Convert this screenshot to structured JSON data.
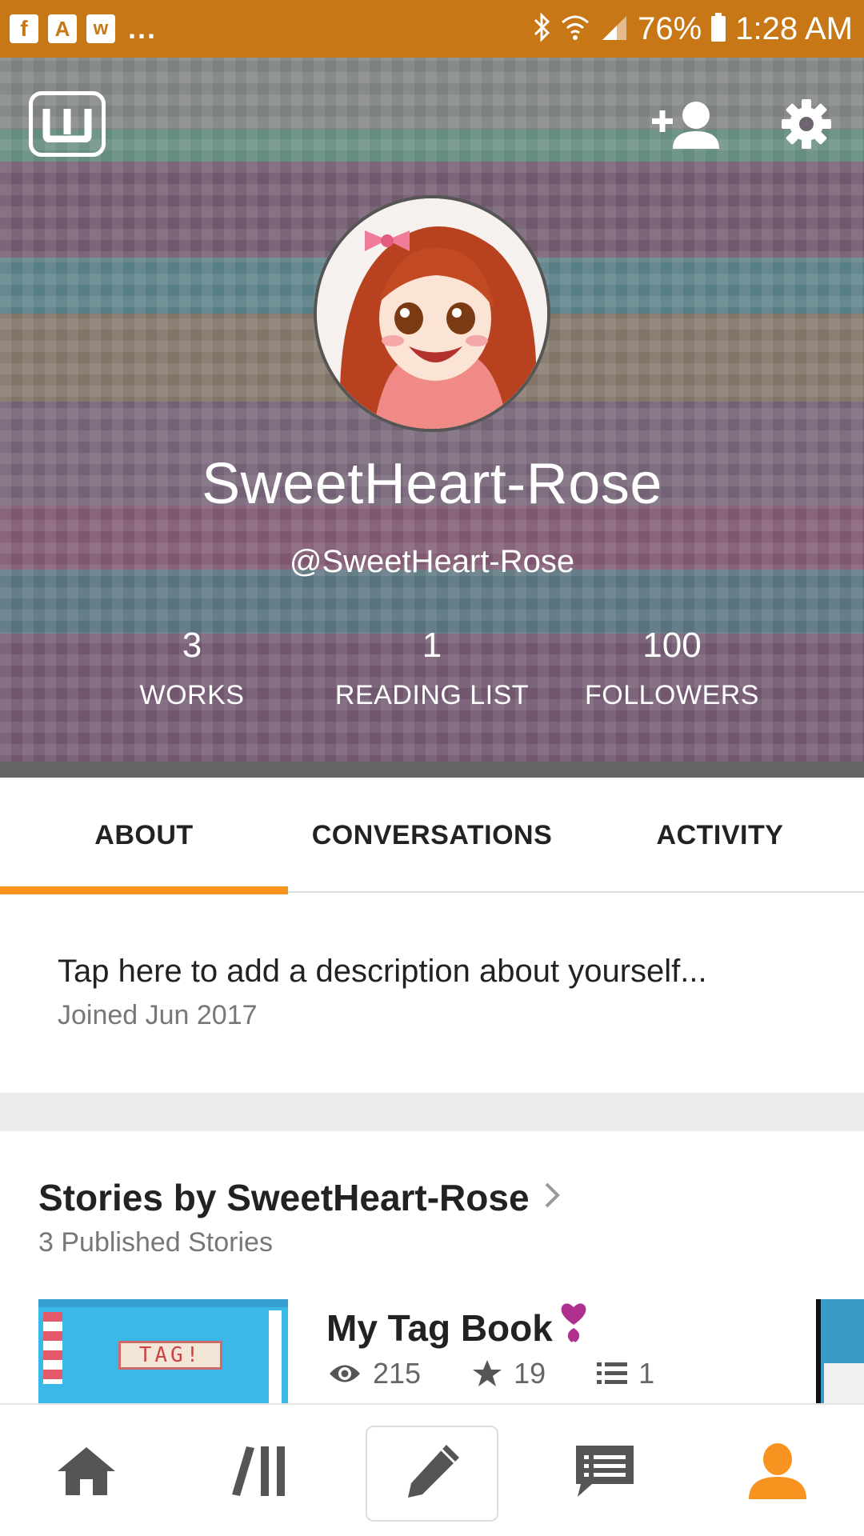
{
  "status_bar": {
    "left_apps": [
      "facebook-icon",
      "a-app-icon",
      "wattpad-icon"
    ],
    "overflow": "...",
    "battery": "76%",
    "time": "1:28 AM"
  },
  "profile": {
    "display_name": "SweetHeart-Rose",
    "username": "@SweetHeart-Rose",
    "stats": [
      {
        "value": "3",
        "label": "WORKS"
      },
      {
        "value": "1",
        "label": "READING LIST"
      },
      {
        "value": "100",
        "label": "FOLLOWERS"
      }
    ]
  },
  "tabs": [
    {
      "label": "ABOUT",
      "active": true
    },
    {
      "label": "CONVERSATIONS",
      "active": false
    },
    {
      "label": "ACTIVITY",
      "active": false
    }
  ],
  "about": {
    "description": "Tap here to add a description about yourself...",
    "joined": "Joined Jun 2017"
  },
  "stories": {
    "title": "Stories by SweetHeart-Rose",
    "subtitle": "3 Published Stories",
    "items": [
      {
        "title": "My Tag Book",
        "cover_text": "TAG!",
        "reads": "215",
        "votes": "19",
        "parts": "1"
      }
    ]
  },
  "colors": {
    "status_bar": "#c87716",
    "accent": "#f7931e",
    "nav_active": "#f7931e",
    "nav_inactive": "#555555"
  },
  "bottom_nav": [
    {
      "icon": "home-icon",
      "active": false
    },
    {
      "icon": "library-icon",
      "active": false
    },
    {
      "icon": "write-pencil-icon",
      "active": false
    },
    {
      "icon": "messages-icon",
      "active": false
    },
    {
      "icon": "profile-icon",
      "active": true
    }
  ]
}
